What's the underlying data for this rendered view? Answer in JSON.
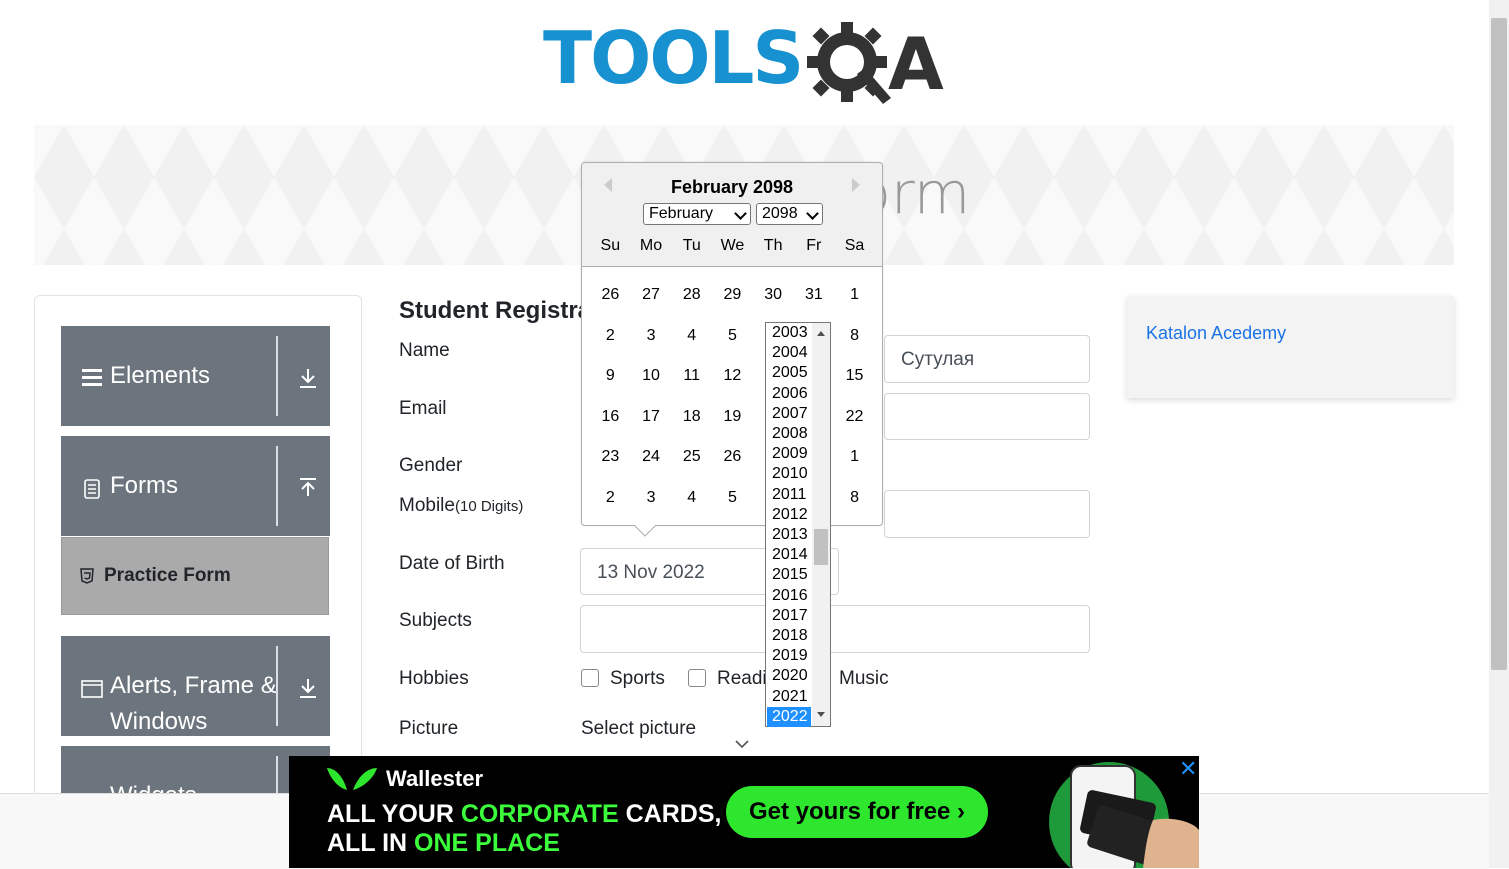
{
  "header": {
    "logo_text": "TOOLS",
    "logo_suffix": "A",
    "banner_title": "Practice Form"
  },
  "sidebar": {
    "groups": [
      {
        "label": "Elements",
        "icon": "hamburger-icon",
        "arrow": "download-icon"
      },
      {
        "label": "Forms",
        "icon": "document-icon",
        "arrow": "upload-icon"
      },
      {
        "label": "Alerts, Frame &",
        "label2": "Windows",
        "icon": "window-icon",
        "arrow": "download-icon"
      },
      {
        "label": "Widgets",
        "icon": "widget-icon",
        "arrow": "download-icon"
      }
    ],
    "active_item": "Practice Form"
  },
  "form": {
    "heading": "Student Registra",
    "labels": {
      "name": "Name",
      "email": "Email",
      "gender": "Gender",
      "mobile": "Mobile",
      "mobile_hint": "(10 Digits)",
      "dob": "Date of Birth",
      "subjects": "Subjects",
      "hobbies": "Hobbies",
      "picture": "Picture"
    },
    "last_name_value": "Сутулая",
    "dob_value": "13 Nov 2022",
    "hobbies": [
      "Sports",
      "Readi",
      "Music"
    ],
    "picture_text": "Select picture"
  },
  "datepicker": {
    "title": "February 2098",
    "month_select": "February",
    "year_select": "2098",
    "weekdays": [
      "Su",
      "Mo",
      "Tu",
      "We",
      "Th",
      "Fr",
      "Sa"
    ],
    "weeks": [
      [
        "26",
        "27",
        "28",
        "29",
        "30",
        "31",
        "1"
      ],
      [
        "2",
        "3",
        "4",
        "5",
        "",
        "",
        "8"
      ],
      [
        "9",
        "10",
        "11",
        "12",
        "",
        "",
        "15"
      ],
      [
        "16",
        "17",
        "18",
        "19",
        "",
        "",
        "22"
      ],
      [
        "23",
        "24",
        "25",
        "26",
        "",
        "",
        "1"
      ],
      [
        "2",
        "3",
        "4",
        "5",
        "",
        "",
        "8"
      ]
    ]
  },
  "year_dropdown": {
    "years": [
      "2003",
      "2004",
      "2005",
      "2006",
      "2007",
      "2008",
      "2009",
      "2010",
      "2011",
      "2012",
      "2013",
      "2014",
      "2015",
      "2016",
      "2017",
      "2018",
      "2019",
      "2020",
      "2021",
      "2022"
    ],
    "selected": "2022"
  },
  "right_ad": {
    "link_text": "Katalon Acedemy"
  },
  "bottom_ad": {
    "brand": "Wallester",
    "line1_a": "ALL YOUR ",
    "line1_b": "CORPORATE",
    "line1_c": " CARDS,",
    "line2_a": "ALL IN ",
    "line2_b": "ONE PLACE",
    "button": "Get yours for free ›",
    "close": "✕"
  },
  "colors": {
    "sidebar_group": "#6c757d",
    "active_item": "#aaaaaa",
    "logo_blue": "#1891d1",
    "link": "#1a73e8",
    "ad_green": "#2fe62f",
    "selected_year": "#1e90ff"
  }
}
